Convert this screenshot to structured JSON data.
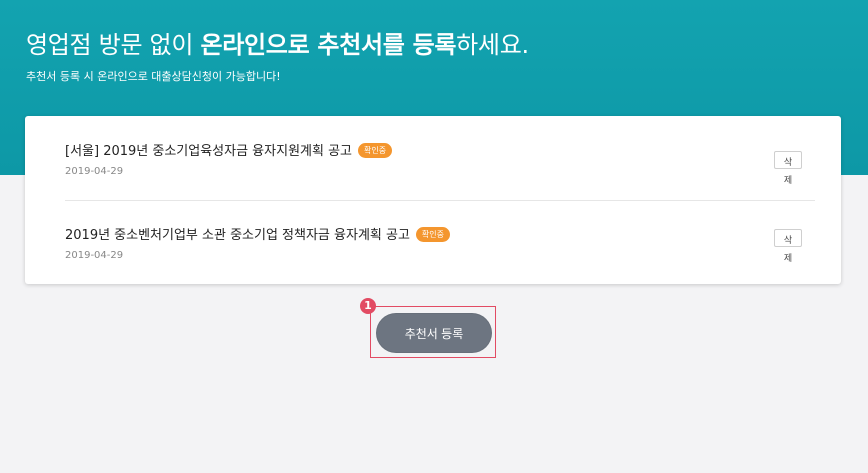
{
  "hero": {
    "title_pre": "영업점 방문 없이 ",
    "title_bold1": "온라인으로 추천서를 등록",
    "title_post": "하세요.",
    "subtitle": "추천서 등록 시 온라인으로 대출상담신청이 가능합니다!"
  },
  "items": [
    {
      "title": "[서울] 2019년 중소기업육성자금 융자지원계획 공고",
      "badge": "확인중",
      "date": "2019-04-29",
      "delete_label": "삭제"
    },
    {
      "title": "2019년 중소벤처기업부 소관 중소기업 정책자금 융자계획 공고",
      "badge": "확인중",
      "date": "2019-04-29",
      "delete_label": "삭제"
    }
  ],
  "step_marker": "1",
  "register_button": "추천서 등록",
  "colors": {
    "hero": "#13a3b0",
    "badge": "#f4962e",
    "button": "#6d7581",
    "highlight": "#e24b63"
  }
}
